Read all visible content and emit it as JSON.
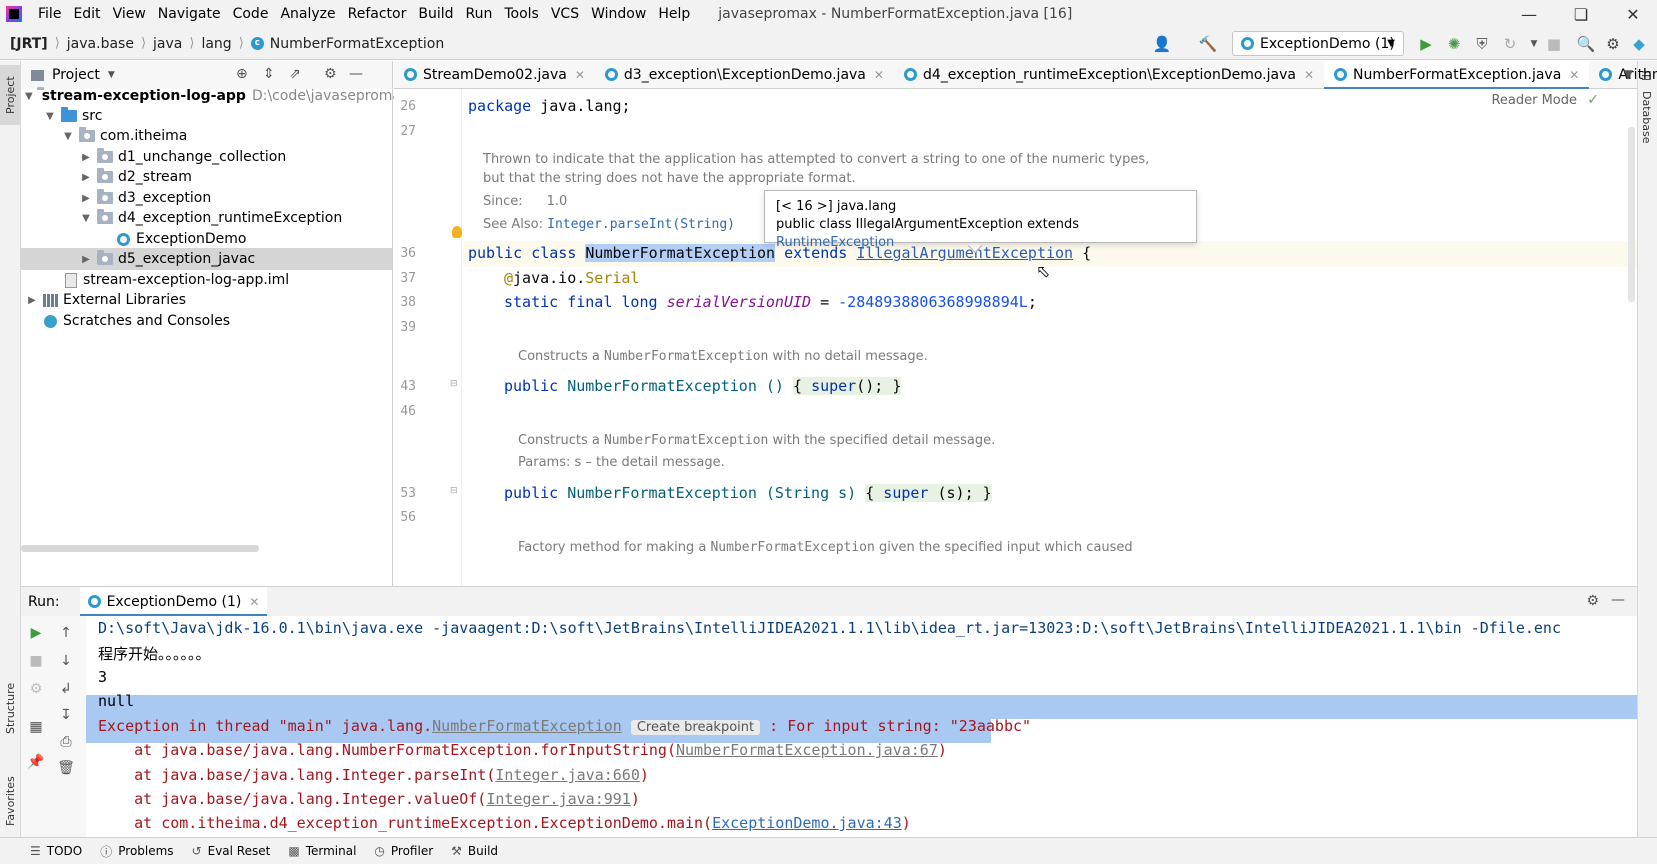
{
  "menubar": {
    "items": [
      "File",
      "Edit",
      "View",
      "Navigate",
      "Code",
      "Analyze",
      "Refactor",
      "Build",
      "Run",
      "Tools",
      "VCS",
      "Window",
      "Help"
    ],
    "window_title": "javasepromax - NumberFormatException.java [16]"
  },
  "navbar": {
    "crumbs": [
      "[JRT]",
      "java.base",
      "java",
      "lang",
      "NumberFormatException"
    ],
    "run_config": "ExceptionDemo (1)"
  },
  "left_strip": {
    "project": "Project",
    "structure": "Structure",
    "favorites": "Favorites"
  },
  "right_strip": {
    "database": "Database"
  },
  "project_panel": {
    "title": "Project",
    "tree": [
      {
        "label": "stream-exception-log-app",
        "path": "D:\\code\\javasepromax\\"
      },
      {
        "label": "src"
      },
      {
        "label": "com.itheima"
      },
      {
        "label": "d1_unchange_collection"
      },
      {
        "label": "d2_stream"
      },
      {
        "label": "d3_exception"
      },
      {
        "label": "d4_exception_runtimeException"
      },
      {
        "label": "ExceptionDemo"
      },
      {
        "label": "d5_exception_javac"
      },
      {
        "label": "stream-exception-log-app.iml"
      },
      {
        "label": "External Libraries"
      },
      {
        "label": "Scratches and Consoles"
      }
    ]
  },
  "editor": {
    "tabs": [
      {
        "label": "StreamDemo02.java"
      },
      {
        "label": "d3_exception\\ExceptionDemo.java"
      },
      {
        "label": "d4_exception_runtimeException\\ExceptionDemo.java"
      },
      {
        "label": "NumberFormatException.java",
        "active": true
      },
      {
        "label": "ArithmeticExce"
      }
    ],
    "reader_mode": "Reader Mode",
    "line_numbers": [
      "26",
      "27",
      "36",
      "37",
      "38",
      "39",
      "43",
      "46",
      "53",
      "56"
    ],
    "code": {
      "package_kw": "package",
      "package_name": " java.lang;",
      "public_kw": "public",
      "class_kw": "class",
      "class_name": "NumberFormatException",
      "extends_kw": "extends",
      "super_class": "IllegalArgumentException",
      "open_brace": " {",
      "annotation_at": "@",
      "annotation_pkg": "java.io.",
      "annotation_name": "Serial",
      "field_mods": "static final long",
      "field_name": "serialVersionUID",
      "field_eq": " = ",
      "field_value": "-2848938806368998894L",
      "field_end": ";",
      "ctor1_sig": "NumberFormatException ()",
      "ctor1_body_open": "{ ",
      "ctor1_super": "super",
      "ctor1_body_close": "(); }",
      "ctor2_sig": "NumberFormatException (String s)",
      "ctor2_body_open": "{ ",
      "ctor2_super": "super",
      "ctor2_body_close": " (s); }"
    },
    "docs": {
      "class_doc_1": "Thrown to indicate that the application has attempted to convert a string to one of the numeric types,",
      "class_doc_2": "but that the string does not have the appropriate format.",
      "since_label": "Since:",
      "since_value": "1.0",
      "see_also_label": "See Also:",
      "see_also_value": "Integer.parseInt(String)",
      "ctor1_doc_pre": "Constructs a ",
      "ctor1_doc_code": "NumberFormatException",
      "ctor1_doc_post": " with no detail message.",
      "ctor2_doc_pre": "Constructs a ",
      "ctor2_doc_code": "NumberFormatException",
      "ctor2_doc_post": " with the specified detail message.",
      "ctor2_params": "Params: s – the detail message.",
      "factory_doc_pre": "Factory method for making a ",
      "factory_doc_code": "NumberFormatException",
      "factory_doc_post": " given the specified input which caused"
    },
    "popup": {
      "line1": "[< 16 >] java.lang",
      "line2_pre": "public class IllegalArgumentException extends ",
      "line2_link": "RuntimeException"
    }
  },
  "run_panel": {
    "label": "Run:",
    "tab": "ExceptionDemo (1)",
    "console": {
      "cmd": "D:\\soft\\Java\\jdk-16.0.1\\bin\\java.exe -javaagent:D:\\soft\\JetBrains\\IntelliJIDEA2021.1.1\\lib\\idea_rt.jar=13023:D:\\soft\\JetBrains\\IntelliJIDEA2021.1.1\\bin -Dfile.enc",
      "line_start": "程序开始。。。。。。",
      "line_3": "3",
      "line_null": "null",
      "exc_pre": "Exception in thread \"main\" java.lang.",
      "exc_link": "NumberFormatException",
      "create_breakpoint": "Create breakpoint",
      "exc_post": ": For input string: \"23aabbc\"",
      "trace1_pre": "    at java.base/java.lang.NumberFormatException.forInputString(",
      "trace1_link": "NumberFormatException.java:67",
      "trace1_post": ")",
      "trace2_pre": "    at java.base/java.lang.Integer.parseInt(",
      "trace2_link": "Integer.java:660",
      "trace2_post": ")",
      "trace3_pre": "    at java.base/java.lang.Integer.valueOf(",
      "trace3_link": "Integer.java:991",
      "trace3_post": ")",
      "trace4_pre": "    at com.itheima.d4_exception_runtimeException.ExceptionDemo.main(",
      "trace4_link": "ExceptionDemo.java:43",
      "trace4_post": ")"
    }
  },
  "bottombar": {
    "items": [
      "TODO",
      "Problems",
      "Eval Reset",
      "Terminal",
      "Profiler",
      "Build"
    ]
  },
  "colors": {
    "keyword": "#0033b3",
    "error_text": "#a8161d",
    "selection": "#a9c9f2",
    "accent": "#4083c9"
  }
}
